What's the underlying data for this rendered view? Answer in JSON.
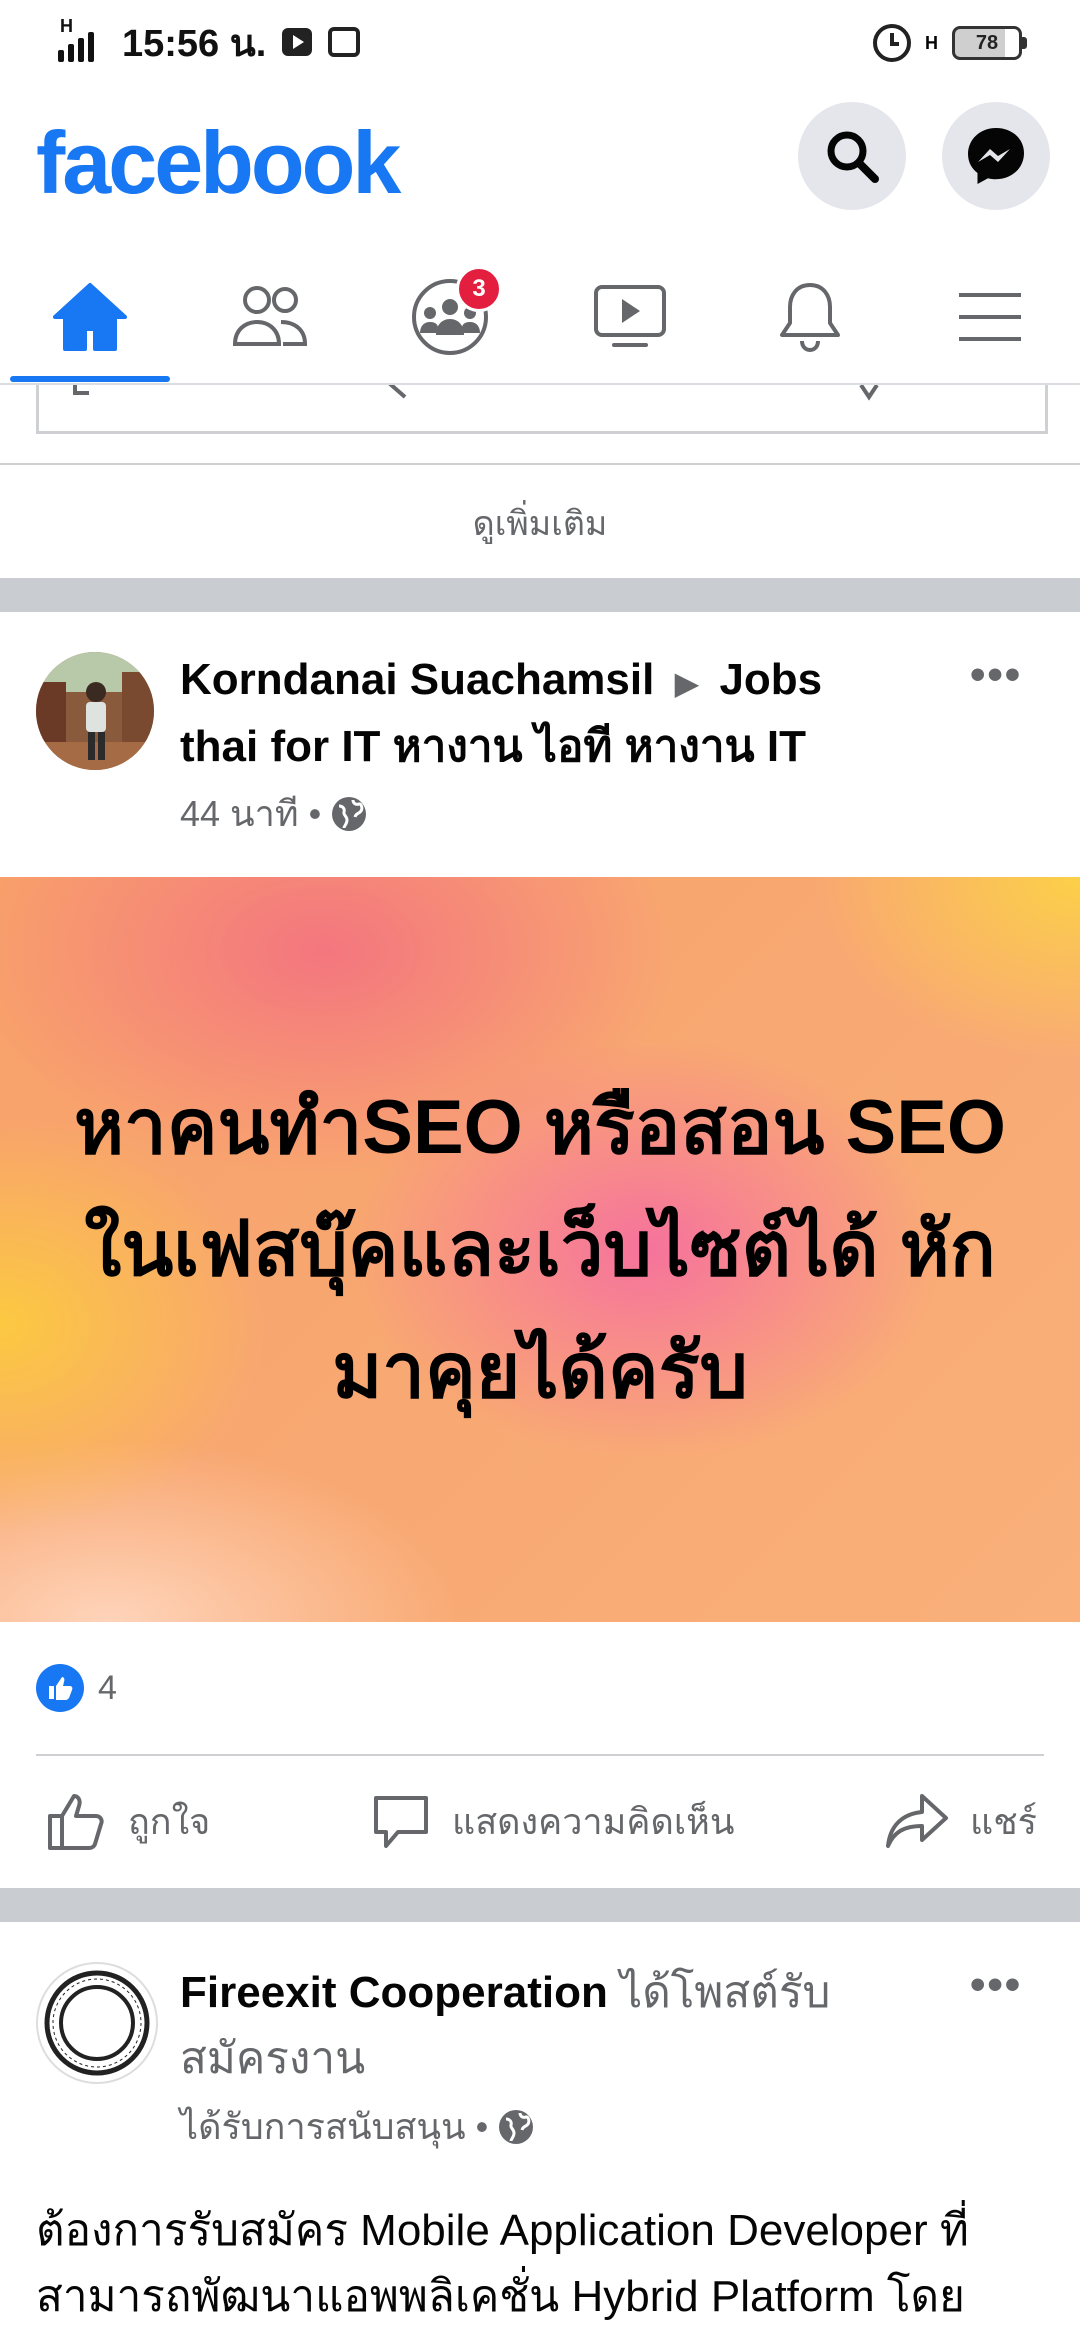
{
  "status_bar": {
    "time": "15:56 น.",
    "network_small": "H",
    "battery": "78"
  },
  "header": {
    "logo": "facebook"
  },
  "nav": {
    "groups_badge": "3"
  },
  "feed": {
    "see_more": "ดูเพิ่มเติม",
    "post1": {
      "author": "Korndanai Suachamsil",
      "arrow": "▶",
      "group": "Jobs thai for IT หางาน ไอที หางาน IT",
      "time": "44 นาที",
      "separator": "•",
      "body": "หาคนทำSEO หรือสอน SEO ในเฟสบุ๊คและเว็บไซต์ได้ หักมาคุยได้ครับ",
      "likes": "4",
      "actions": {
        "like": "ถูกใจ",
        "comment": "แสดงความคิดเห็น",
        "share": "แชร์"
      }
    },
    "post2": {
      "author": "Fireexit Cooperation",
      "action": "ได้โพสต์รับสมัครงาน",
      "sponsored": "ได้รับการสนับสนุน",
      "separator": "•",
      "body": "ต้องการรับสมัคร Mobile Application Developer ที่สามารถพัฒนาแอพพลิเคชั่น Hybrid Platform โดย"
    }
  },
  "colors": {
    "brand": "#1877f2",
    "badge": "#e41e3f",
    "secondary_text": "#65676b",
    "divider": "#c9ccd1"
  }
}
